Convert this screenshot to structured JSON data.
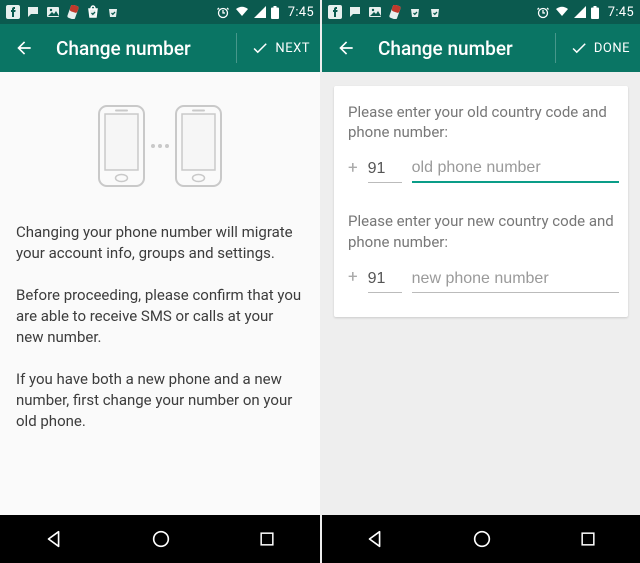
{
  "status": {
    "time": "7:45"
  },
  "appbar_left": {
    "title": "Change number",
    "action": "NEXT"
  },
  "appbar_right": {
    "title": "Change number",
    "action": "DONE"
  },
  "left": {
    "p1": "Changing your phone number will migrate your account info, groups and settings.",
    "p2": "Before proceeding, please confirm that you are able to receive SMS or calls at your new number.",
    "p3": "If you have both a new phone and a new number, first change your number on your old phone."
  },
  "right": {
    "old_prompt": "Please enter your old country code and phone number:",
    "old_cc": "91",
    "old_placeholder": "old phone number",
    "new_prompt": "Please enter your new country code and phone number:",
    "new_cc": "91",
    "new_placeholder": "new phone number"
  }
}
